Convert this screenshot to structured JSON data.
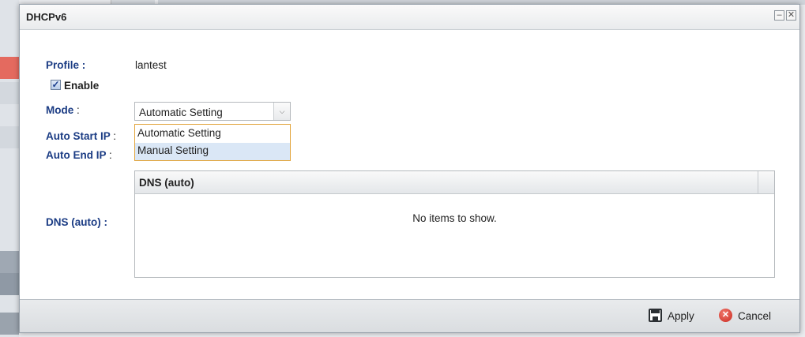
{
  "dialog": {
    "title": "DHCPv6",
    "minimize_glyph": "–",
    "close_glyph": "✕"
  },
  "form": {
    "profile_label": "Profile :",
    "profile_value": "lantest",
    "enable_label": "Enable",
    "enable_checked": true,
    "mode_label": "Mode",
    "auto_start_ip_label": "Auto Start IP",
    "auto_end_ip_label": "Auto End IP",
    "colon": ":",
    "mode_selected": "Automatic Setting",
    "mode_options": [
      "Automatic Setting",
      "Manual Setting"
    ],
    "dns_label": "DNS (auto) :"
  },
  "dns_grid": {
    "column_header": "DNS (auto)",
    "empty_text": "No items to show."
  },
  "footer": {
    "apply_label": "Apply",
    "cancel_label": "Cancel"
  },
  "icons": {
    "apply": "save-icon",
    "cancel": "cancel-icon",
    "checkbox": "check-icon",
    "dropdown": "chevron-down-icon"
  },
  "colors": {
    "label_blue": "#1b3c84",
    "dropdown_border": "#e2a53c",
    "hover_row": "#dae7f6",
    "cancel_red": "#c9281f"
  }
}
